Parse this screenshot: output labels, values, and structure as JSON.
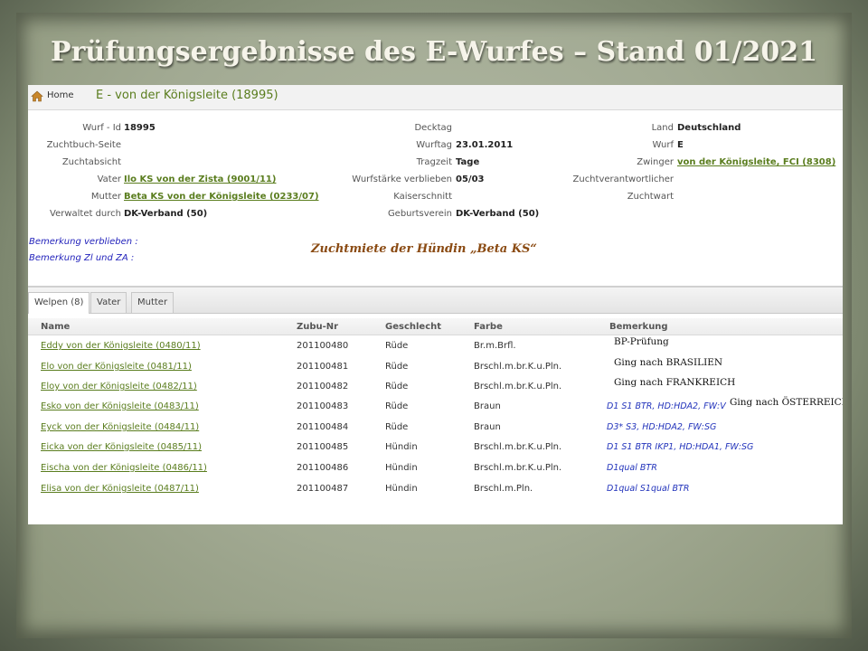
{
  "slide": {
    "title": "Prüfungsergebnisse des E-Wurfes – Stand 01/2021",
    "annotation": "Zuchtmiete der Hündin „Beta KS“"
  },
  "breadcrumb": {
    "home_label": "Home",
    "page_title": "E - von der Königsleite (18995)"
  },
  "info": {
    "col1": [
      {
        "label": "Wurf - Id",
        "value": "18995",
        "link": false
      },
      {
        "label": "Zuchtbuch-Seite",
        "value": "",
        "link": false
      },
      {
        "label": "Zuchtabsicht",
        "value": "",
        "link": false
      },
      {
        "label": "Vater",
        "value": "Ilo KS von der Zista (9001/11)",
        "link": true
      },
      {
        "label": "Mutter",
        "value": "Beta KS von der Königsleite (0233/07)",
        "link": true
      },
      {
        "label": "Verwaltet durch",
        "value": "DK-Verband (50)",
        "link": false
      }
    ],
    "col2": [
      {
        "label": "Decktag",
        "value": ""
      },
      {
        "label": "Wurftag",
        "value": "23.01.2011"
      },
      {
        "label": "Tragzeit",
        "value": "Tage"
      },
      {
        "label": "Wurfstärke verblieben",
        "value": "05/03"
      },
      {
        "label": "Kaiserschnitt",
        "value": ""
      },
      {
        "label": "Geburtsverein",
        "value": "DK-Verband (50)"
      }
    ],
    "col3": [
      {
        "label": "Land",
        "value": "Deutschland",
        "link": false
      },
      {
        "label": "Wurf",
        "value": "E",
        "link": false
      },
      {
        "label": "Zwinger",
        "value": "von der Königsleite, FCI (8308)",
        "link": true
      },
      {
        "label": "Zuchtverantwortlicher",
        "value": "",
        "link": false
      },
      {
        "label": "Zuchtwart",
        "value": "",
        "link": false
      }
    ]
  },
  "remarks": {
    "verblieben": "Bemerkung verblieben :",
    "zl_za": "Bemerkung Zl und ZA :"
  },
  "tabs": [
    {
      "label": "Welpen (8)",
      "active": true
    },
    {
      "label": "Vater",
      "active": false
    },
    {
      "label": "Mutter",
      "active": false
    }
  ],
  "table": {
    "headers": [
      "Name",
      "Zubu-Nr",
      "Geschlecht",
      "Farbe",
      "Bemerkung"
    ],
    "rows": [
      {
        "name": "Eddy von der Königsleite (0480/11)",
        "zubu": "201100480",
        "sex": "Rüde",
        "color": "Br.m.Brfl.",
        "remark": "",
        "note": "BP-Prüfung"
      },
      {
        "name": "Elo von der Königsleite (0481/11)",
        "zubu": "201100481",
        "sex": "Rüde",
        "color": "Brschl.m.br.K.u.Pln.",
        "remark": "",
        "note": "Ging nach  BRASILIEN"
      },
      {
        "name": "Eloy von der Königsleite (0482/11)",
        "zubu": "201100482",
        "sex": "Rüde",
        "color": "Brschl.m.br.K.u.Pln.",
        "remark": "",
        "note": "Ging nach FRANKREICH"
      },
      {
        "name": "Esko von der Königsleite (0483/11)",
        "zubu": "201100483",
        "sex": "Rüde",
        "color": "Braun",
        "remark": "D1 S1 BTR, HD:HDA2, FW:V",
        "note": "Ging nach  ÖSTERREICH"
      },
      {
        "name": "Eyck von der Königsleite (0484/11)",
        "zubu": "201100484",
        "sex": "Rüde",
        "color": "Braun",
        "remark": "D3* S3, HD:HDA2, FW:SG",
        "note": ""
      },
      {
        "name": "Eicka von der Königsleite (0485/11)",
        "zubu": "201100485",
        "sex": "Hündin",
        "color": "Brschl.m.br.K.u.Pln.",
        "remark": "D1 S1 BTR IKP1, HD:HDA1, FW:SG",
        "note": ""
      },
      {
        "name": "Eischa von der Königsleite (0486/11)",
        "zubu": "201100486",
        "sex": "Hündin",
        "color": "Brschl.m.br.K.u.Pln.",
        "remark": "D1qual BTR",
        "note": ""
      },
      {
        "name": "Elisa von der Königsleite (0487/11)",
        "zubu": "201100487",
        "sex": "Hündin",
        "color": "Brschl.m.Pln.",
        "remark": "D1qual S1qual BTR",
        "note": ""
      }
    ]
  },
  "colors": {
    "link": "#5a7d1e",
    "remark": "#2233bb",
    "title_text": "#f6f4ea",
    "annotation": "#8a4a12"
  }
}
